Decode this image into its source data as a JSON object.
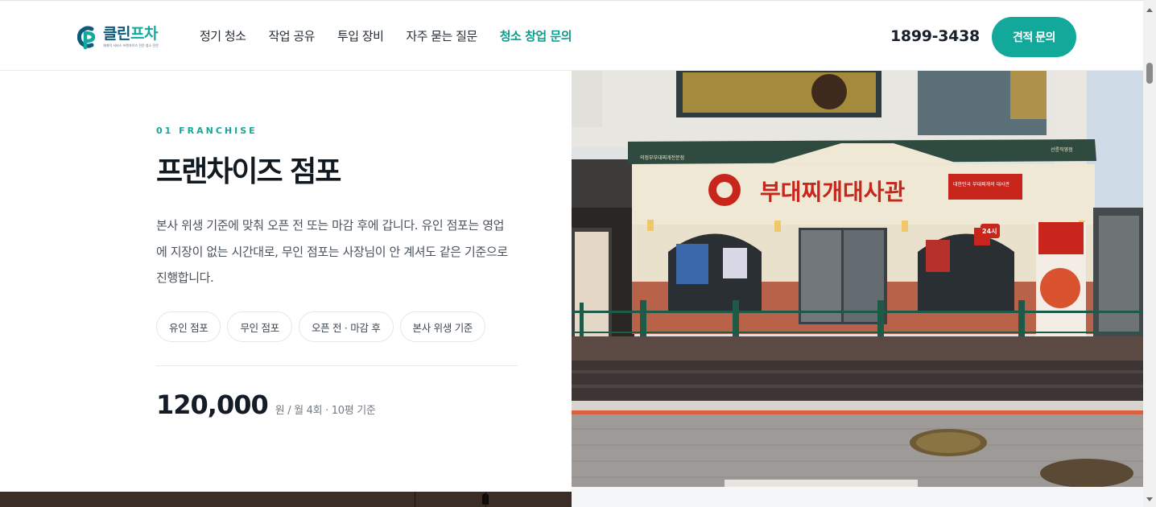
{
  "header": {
    "logo": {
      "name_main": "클린",
      "name_accent": "프차",
      "tagline": "체계적 서비스 프랜차이즈 전문 청소 전문"
    },
    "nav": [
      {
        "label": "정기 청소",
        "active": false
      },
      {
        "label": "작업 공유",
        "active": false
      },
      {
        "label": "투입 장비",
        "active": false
      },
      {
        "label": "자주 묻는 질문",
        "active": false
      },
      {
        "label": "청소 창업 문의",
        "active": true
      }
    ],
    "phone": "1899-3438",
    "cta_label": "견적 문의"
  },
  "section": {
    "eyebrow": "01  FRANCHISE",
    "title": "프랜차이즈 점포",
    "description": "본사 위생 기준에 맞춰 오픈 전 또는 마감 후에 갑니다. 유인 점포는 영업에 지장이 없는 시간대로, 무인 점포는 사장님이 안 계셔도 같은 기준으로 진행합니다.",
    "tags": [
      "유인 점포",
      "무인 점포",
      "오픈 전 · 마감 후",
      "본사 위생 기준"
    ],
    "price_value": "120,000",
    "price_unit": "원 / 월 4회 · 10평 기준"
  },
  "photo": {
    "sign_main": "부대찌개대사관",
    "sign_sub": "의정부부대찌개전문점",
    "sign_side": "대한민국 부대찌개의 대사관",
    "sign_branch": "선릉직영점",
    "badge": "24시",
    "colors": {
      "awning": "#2f4b3f",
      "facade": "#efe8d5",
      "brick": "#b9624a",
      "sign_red": "#c8251c",
      "fence": "#1f5a49"
    }
  },
  "colors": {
    "accent": "#12a89a",
    "text_dark": "#111921",
    "text_body": "#4a525b"
  }
}
